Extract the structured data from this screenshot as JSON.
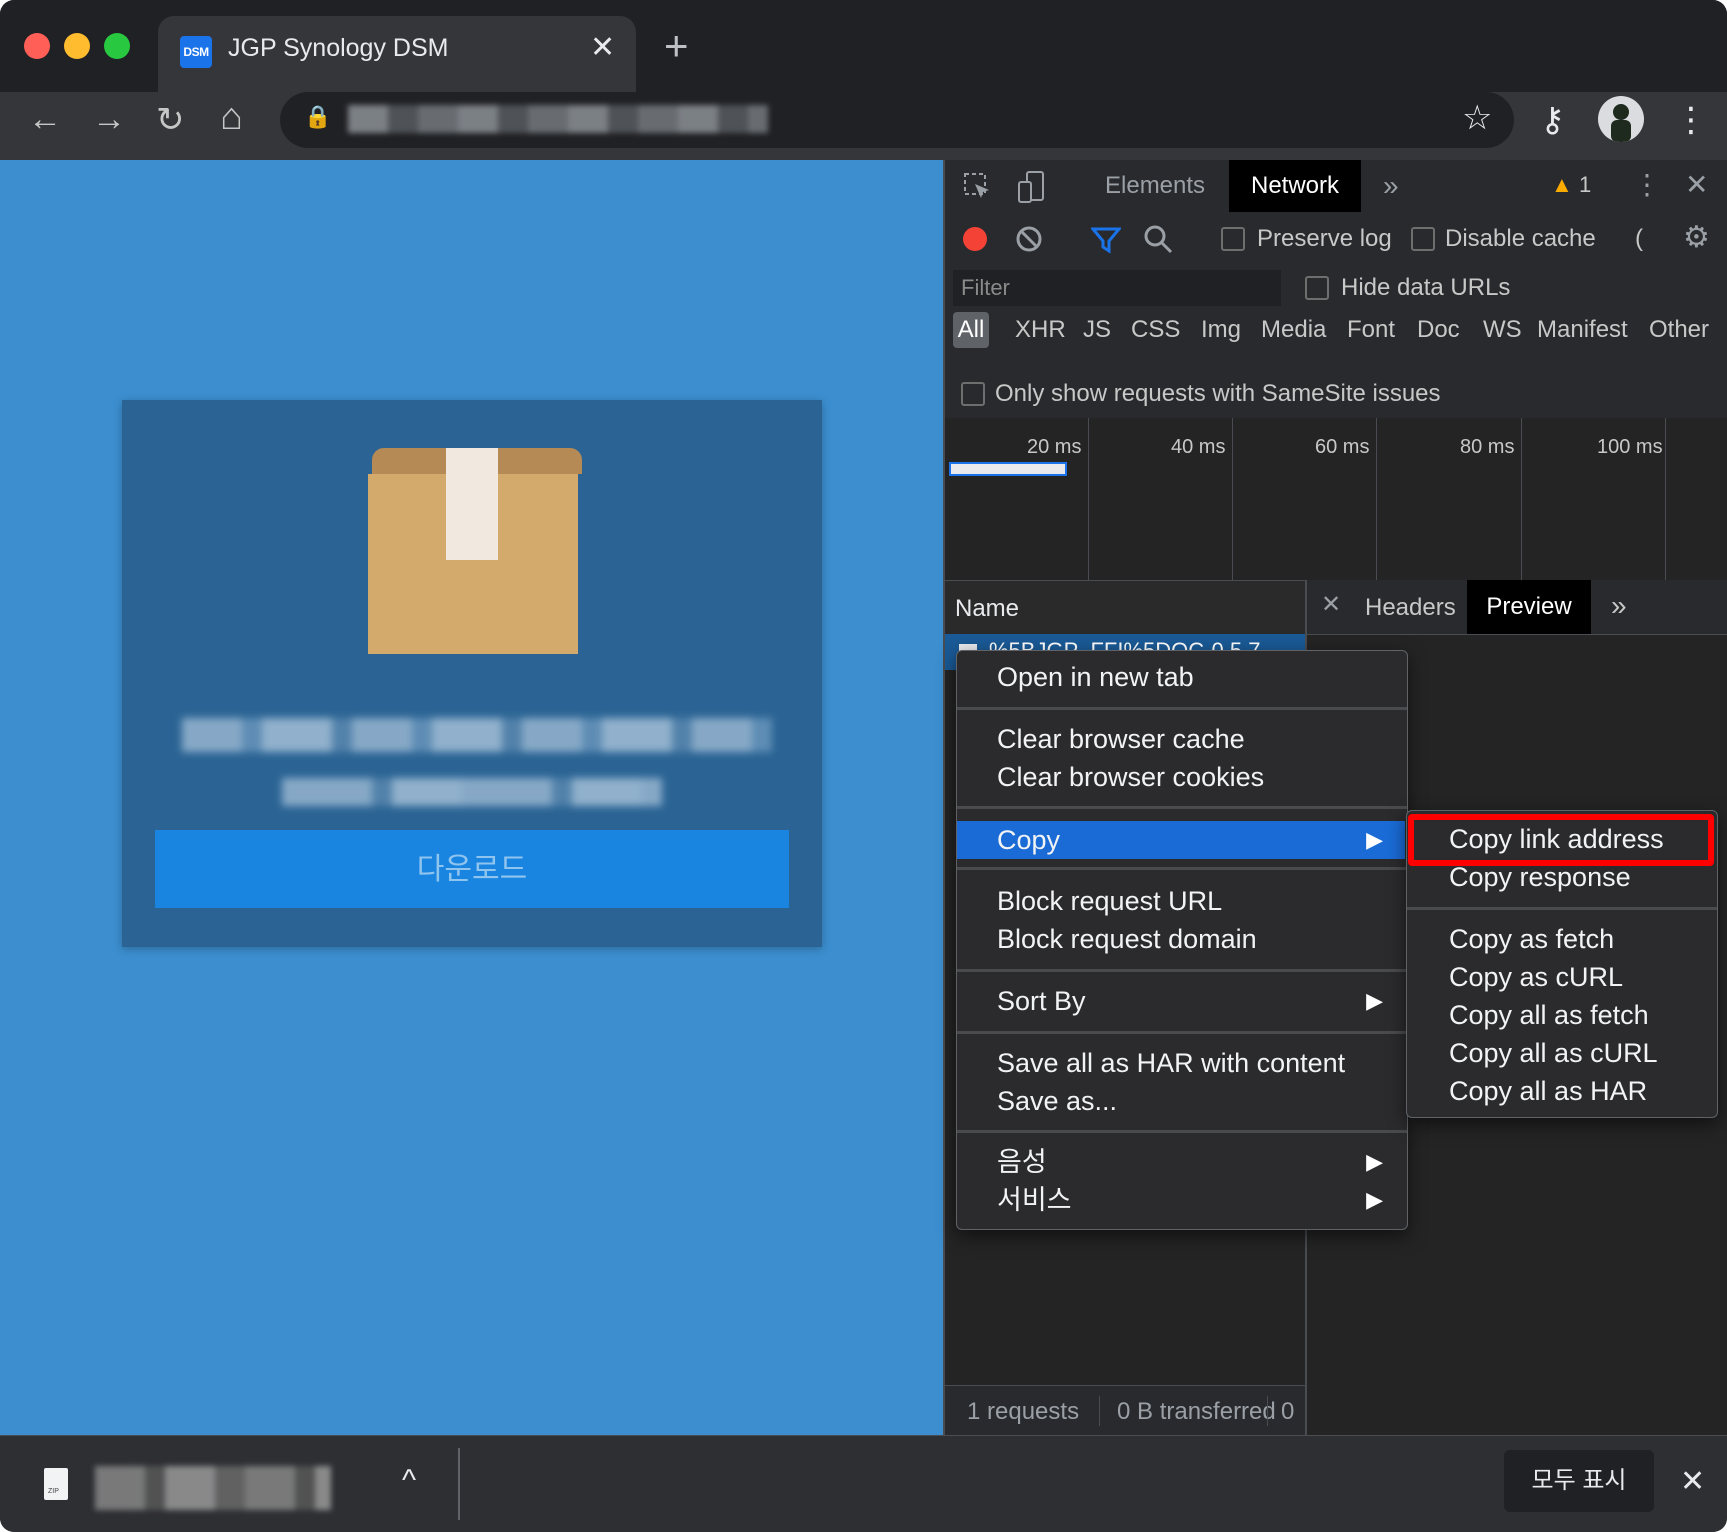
{
  "tab": {
    "title": "JGP Synology DSM",
    "favicon_text": "DSM",
    "close": "✕"
  },
  "newtab_label": "+",
  "toolbar": {
    "back": "←",
    "forward": "→",
    "reload": "↻",
    "home": "⌂",
    "lock": "🔒",
    "star": "☆",
    "key": "⚷",
    "menu": "⋮"
  },
  "page": {
    "download_button": "다운로드"
  },
  "devtools": {
    "tabs": [
      "Elements",
      "Network"
    ],
    "more": "»",
    "warning_count": "1",
    "preserve_log": "Preserve log",
    "disable_cache": "Disable cache",
    "filter_placeholder": "Filter",
    "hide_data_urls": "Hide data URLs",
    "types": [
      "All",
      "XHR",
      "JS",
      "CSS",
      "Img",
      "Media",
      "Font",
      "Doc",
      "WS",
      "Manifest",
      "Other"
    ],
    "samesite": "Only show requests with SameSite issues",
    "timeline_labels": [
      "20 ms",
      "40 ms",
      "60 ms",
      "80 ms",
      "100 ms"
    ],
    "name_header": "Name",
    "request_name": "%5BJGP_FFI%5DOC-0.5.7",
    "detail_tabs": [
      "Headers",
      "Preview"
    ],
    "status": {
      "requests": "1 requests",
      "transferred": "0 B transferred",
      "extra": "0"
    }
  },
  "context_menu": {
    "open_new_tab": "Open in new tab",
    "clear_cache": "Clear browser cache",
    "clear_cookies": "Clear browser cookies",
    "copy": "Copy",
    "block_url": "Block request URL",
    "block_domain": "Block request domain",
    "sort_by": "Sort By",
    "save_har": "Save all as HAR with content",
    "save_as": "Save as...",
    "voice": "음성",
    "services": "서비스",
    "arrow": "▶"
  },
  "copy_submenu": {
    "link": "Copy link address",
    "response": "Copy response",
    "fetch": "Copy as fetch",
    "curl": "Copy as cURL",
    "all_fetch": "Copy all as fetch",
    "all_curl": "Copy all as cURL",
    "all_har": "Copy all as HAR"
  },
  "download_bar": {
    "show_all": "모두 표시",
    "expand": "^",
    "close": "✕",
    "file_icon_label": "ZIP"
  },
  "colors": {
    "accent": "#1a73e8",
    "highlight": "#ff0000",
    "page_bg": "#3c8ecf"
  }
}
